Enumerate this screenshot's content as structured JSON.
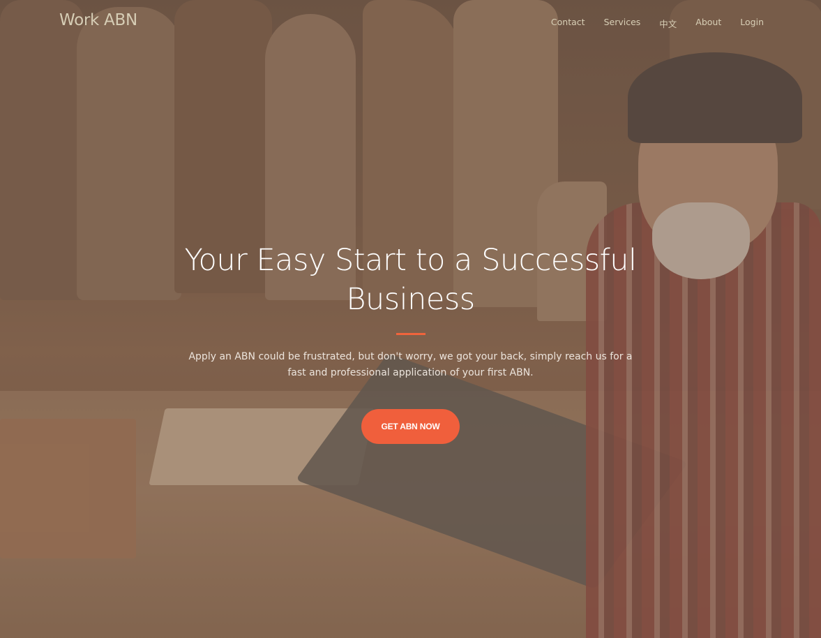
{
  "nav": {
    "brand": "Work ABN",
    "items": [
      {
        "label": "Contact"
      },
      {
        "label": "Services"
      },
      {
        "label": "中文"
      },
      {
        "label": "About"
      },
      {
        "label": "Login"
      }
    ]
  },
  "hero": {
    "headline": "Your Easy Start to a Successful Business",
    "subtext": "Apply an ABN could be frustrated, but don't worry, we got your back, simply reach us for a fast and professional application of your first ABN.",
    "cta_label": "GET ABN NOW",
    "background_image": "woodworker-with-laptop-photo"
  },
  "colors": {
    "accent": "#f05f3c",
    "nav_text": "#d8cfb6",
    "headline": "#ffffff"
  }
}
